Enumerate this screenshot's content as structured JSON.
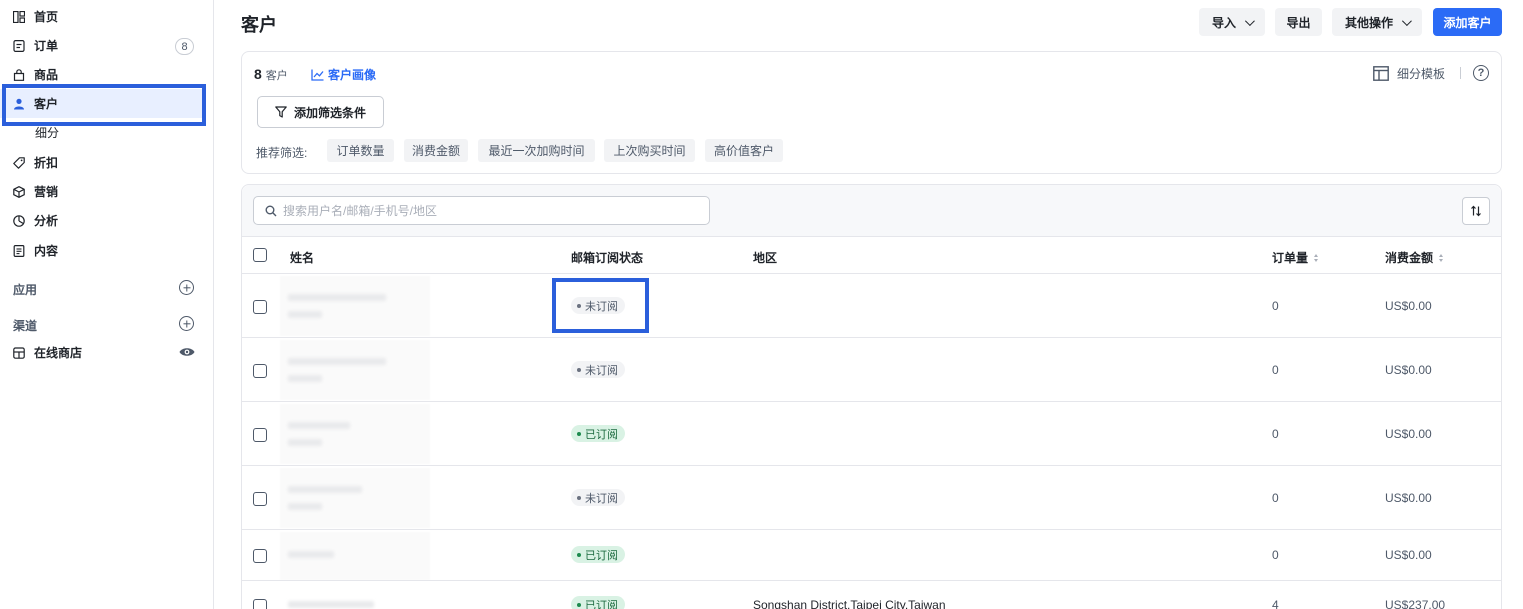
{
  "sidebar": {
    "items": [
      {
        "label": "首页",
        "icon": "dashboard-icon"
      },
      {
        "label": "订单",
        "icon": "order-icon",
        "badge": "8"
      },
      {
        "label": "商品",
        "icon": "bag-icon"
      },
      {
        "label": "客户",
        "icon": "user-icon",
        "active": true
      },
      {
        "label": "细分",
        "sub": true
      },
      {
        "label": "折扣",
        "icon": "tag-icon"
      },
      {
        "label": "营销",
        "icon": "cube-icon"
      },
      {
        "label": "分析",
        "icon": "pie-icon"
      },
      {
        "label": "内容",
        "icon": "doc-icon"
      }
    ],
    "apps_label": "应用",
    "channels_label": "渠道",
    "online_store_label": "在线商店"
  },
  "header": {
    "title": "客户",
    "import_label": "导入",
    "export_label": "导出",
    "more_label": "其他操作",
    "add_customer_label": "添加客户"
  },
  "filters": {
    "count": "8",
    "count_unit": "客户",
    "portrait_label": "客户画像",
    "template_label": "细分模板",
    "help_symbol": "?",
    "add_filter_label": "添加筛选条件",
    "recommend_label": "推荐筛选:",
    "chips": [
      "订单数量",
      "消费金额",
      "最近一次加购时间",
      "上次购买时间",
      "高价值客户"
    ]
  },
  "table": {
    "search_placeholder": "搜索用户名/邮箱/手机号/地区",
    "columns": {
      "name": "姓名",
      "subscription": "邮箱订阅状态",
      "region": "地区",
      "orders": "订单量",
      "spend": "消费金额"
    },
    "rows": [
      {
        "status": "未订阅",
        "subscribed": false,
        "region": "",
        "orders": "0",
        "spend": "US$0.00"
      },
      {
        "status": "未订阅",
        "subscribed": false,
        "region": "",
        "orders": "0",
        "spend": "US$0.00"
      },
      {
        "status": "已订阅",
        "subscribed": true,
        "region": "",
        "orders": "0",
        "spend": "US$0.00"
      },
      {
        "status": "未订阅",
        "subscribed": false,
        "region": "",
        "orders": "0",
        "spend": "US$0.00"
      },
      {
        "status": "已订阅",
        "subscribed": true,
        "region": "",
        "orders": "0",
        "spend": "US$0.00"
      },
      {
        "status": "已订阅",
        "subscribed": true,
        "region": "Songshan District,Taipei City,Taiwan",
        "orders": "4",
        "spend": "US$237.00"
      }
    ]
  },
  "colors": {
    "accent": "#2b6bf6",
    "highlight": "#2b5fdb",
    "subscribed_bg": "#d9f2e4",
    "unsubscribed_bg": "#f2f3f5"
  }
}
